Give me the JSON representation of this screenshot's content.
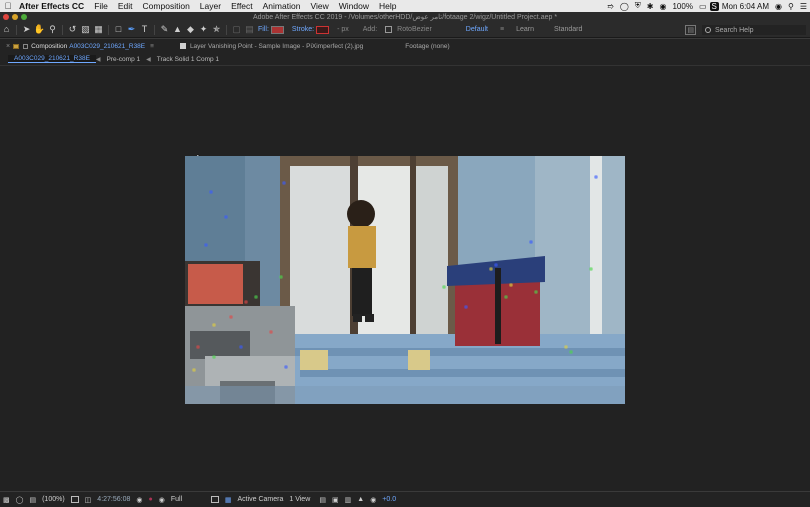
{
  "menubar": {
    "apple_icon": "apple-icon",
    "app_name": "After Effects CC",
    "items": [
      "File",
      "Edit",
      "Composition",
      "Layer",
      "Effect",
      "Animation",
      "View",
      "Window",
      "Help"
    ],
    "battery": "100%",
    "clock": "Mon 6:04 AM",
    "status_icons": [
      "lasso-icon",
      "timer-icon",
      "shield-icon",
      "bluetooth-icon",
      "wifi-icon",
      "battery-icon",
      "dropbox-icon",
      "user-icon",
      "search-icon",
      "list-icon"
    ]
  },
  "window": {
    "title": "Adobe After Effects CC 2019 - /Volumes/otherHDD/تامر عوض/fotaage 2/wigz/Untitled Project.aep *"
  },
  "toolbar": {
    "fill_label": "Fill:",
    "stroke_label": "Stroke:",
    "stroke_width": "- px",
    "add_label": "Add:",
    "rotobezier_label": "RotoBezier",
    "workspaces": [
      "Default",
      "Learn",
      "Standard"
    ],
    "active_workspace": "Default",
    "search_placeholder": "Search Help"
  },
  "panels": {
    "composition_label": "Composition",
    "composition_name": "A003C029_210621_R38E",
    "layer_tab": "Layer Vanishing Point - Sample Image - PiXimperfect (2).jpg",
    "footage_tab": "Footage (none)"
  },
  "breadcrumbs": [
    "A003C029_210621_R38E",
    "Pre-comp 1",
    "Track Solid 1 Comp 1"
  ],
  "statusbar": {
    "zoom": "(100%)",
    "timecode": "4:27:56:08",
    "resolution": "Full",
    "camera": "Active Camera",
    "view_count": "1 View",
    "exposure": "+0.0"
  },
  "colors": {
    "accent": "#6fa8ff",
    "panel_bg": "#232323",
    "viewer_bg": "#222222"
  }
}
